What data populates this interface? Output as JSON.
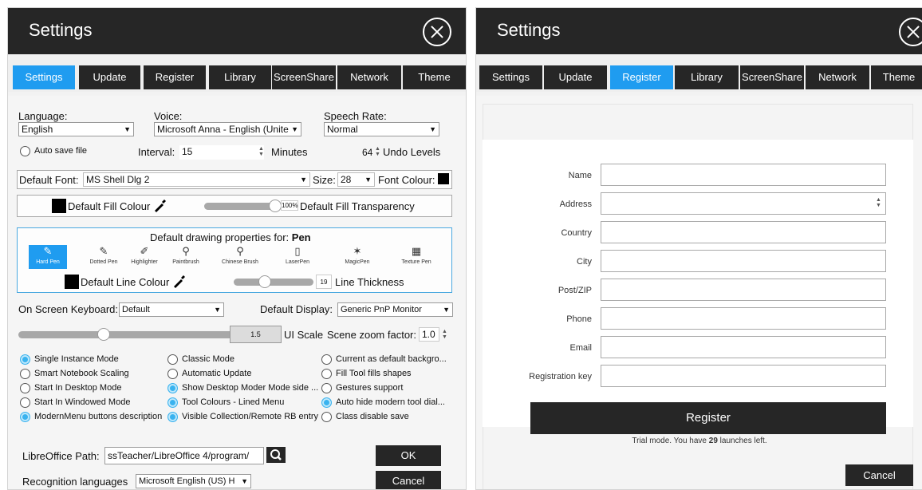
{
  "left": {
    "title": "Settings",
    "tabs": [
      "Settings",
      "Update",
      "Register",
      "Library",
      "ScreenShare",
      "Network",
      "Theme"
    ],
    "active_tab": "Settings",
    "language": {
      "label": "Language:",
      "value": "English"
    },
    "voice": {
      "label": "Voice:",
      "value": "Microsoft Anna - English (Unite"
    },
    "speech_rate": {
      "label": "Speech Rate:",
      "value": "Normal"
    },
    "auto_save": {
      "label": "Auto save file",
      "checked": false
    },
    "interval": {
      "label": "Interval:",
      "value": "15",
      "unit": "Minutes"
    },
    "undo": {
      "value": "64",
      "label": "Undo Levels"
    },
    "font": {
      "label": "Default Font:",
      "value": "MS Shell Dlg 2",
      "size_label": "Size:",
      "size_value": "28",
      "colour_label": "Font Colour:",
      "colour": "#000000"
    },
    "fill": {
      "colour_label": "Default Fill Colour",
      "colour": "#000000",
      "transparency_value": "100%",
      "transparency_fraction": 1.0,
      "transparency_label": "Default Fill Transparency"
    },
    "drawing": {
      "title_prefix": "Default drawing properties for:",
      "title_bold": "Pen",
      "tools": [
        "Hard Pen",
        "Dotted Pen",
        "Highlighter",
        "Paintbrush",
        "Chinese Brush",
        "LaserPen",
        "MagicPen",
        "Texture Pen"
      ],
      "active_tool": "Hard Pen",
      "line_colour_label": "Default Line Colour",
      "line_colour": "#000000",
      "thickness_value": "19",
      "thickness_label": "Line Thickness"
    },
    "keyboard": {
      "label": "On Screen Keyboard:",
      "value": "Default"
    },
    "display": {
      "label": "Default Display:",
      "value": "Generic PnP Monitor"
    },
    "ui_scale": {
      "value": "1.5",
      "label": "UI Scale"
    },
    "zoom": {
      "label": "Scene zoom factor:",
      "value": "1.0"
    },
    "options": [
      {
        "label": "Single Instance Mode",
        "checked": true
      },
      {
        "label": "Classic Mode",
        "checked": false
      },
      {
        "label": "Current as default backgro...",
        "checked": false
      },
      {
        "label": "Smart Notebook Scaling",
        "checked": false
      },
      {
        "label": "Automatic Update",
        "checked": false
      },
      {
        "label": "Fill Tool fills shapes",
        "checked": false
      },
      {
        "label": "Start In Desktop Mode",
        "checked": false
      },
      {
        "label": "Show Desktop Moder Mode side ...",
        "checked": true
      },
      {
        "label": "Gestures support",
        "checked": false
      },
      {
        "label": "Start In Windowed Mode",
        "checked": false
      },
      {
        "label": "Tool Colours - Lined Menu",
        "checked": true
      },
      {
        "label": "Auto hide modern tool dial...",
        "checked": true
      },
      {
        "label": "ModernMenu buttons description",
        "checked": true
      },
      {
        "label": "Visible Collection/Remote RB entry",
        "checked": true
      },
      {
        "label": "Class disable save",
        "checked": false
      }
    ],
    "libre": {
      "label": "LibreOffice Path:",
      "value": "ssTeacher/LibreOffice 4/program/"
    },
    "recognition": {
      "label": "Recognition languages",
      "value": "Microsoft English (US) H"
    },
    "ok_label": "OK",
    "cancel_label": "Cancel"
  },
  "right": {
    "title": "Settings",
    "tabs": [
      "Settings",
      "Update",
      "Register",
      "Library",
      "ScreenShare",
      "Network",
      "Theme"
    ],
    "active_tab": "Register",
    "fields": [
      "Name",
      "Address",
      "Country",
      "City",
      "Post/ZIP",
      "Phone",
      "Email",
      "Registration key"
    ],
    "register_label": "Register",
    "trial_prefix": "Trial mode. You have",
    "trial_count": "29",
    "trial_suffix": "launches left.",
    "cancel_label": "Cancel"
  },
  "colors": {
    "accent": "#1f9cf0",
    "dark": "#262626",
    "radio_on": "#3ab3ef"
  }
}
